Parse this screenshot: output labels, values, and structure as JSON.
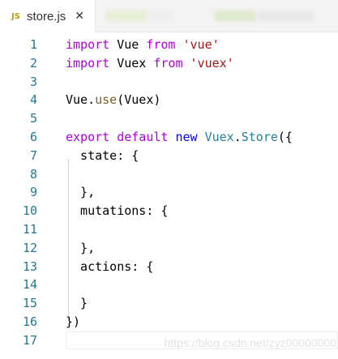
{
  "tab": {
    "icon": "JS",
    "filename": "store.js",
    "close": "✕"
  },
  "line_numbers": [
    "1",
    "2",
    "3",
    "4",
    "5",
    "6",
    "7",
    "8",
    "9",
    "10",
    "11",
    "12",
    "13",
    "14",
    "15",
    "16",
    "17"
  ],
  "code": {
    "l1": {
      "kw": "import",
      "a": " Vue ",
      "b": "from",
      "c": " ",
      "str": "'vue'"
    },
    "l2": {
      "kw": "import",
      "a": " Vuex ",
      "b": "from",
      "c": " ",
      "str": "'vuex'"
    },
    "l4": {
      "obj": "Vue",
      "dot": ".",
      "fn": "use",
      "args": "(Vuex)"
    },
    "l6": {
      "kw1": "export",
      "sp1": " ",
      "kw2": "default",
      "sp2": " ",
      "kw3": "new",
      "sp3": " ",
      "cls": "Vuex",
      "dot": ".",
      "fn": "Store",
      "rest": "({"
    },
    "l7": "  state: {",
    "l9": "  },",
    "l10": "  mutations: {",
    "l12": "  },",
    "l13": "  actions: {",
    "l15": "  }",
    "l16": "})"
  },
  "watermark": "https://blog.csdn.net/zyz00000000"
}
